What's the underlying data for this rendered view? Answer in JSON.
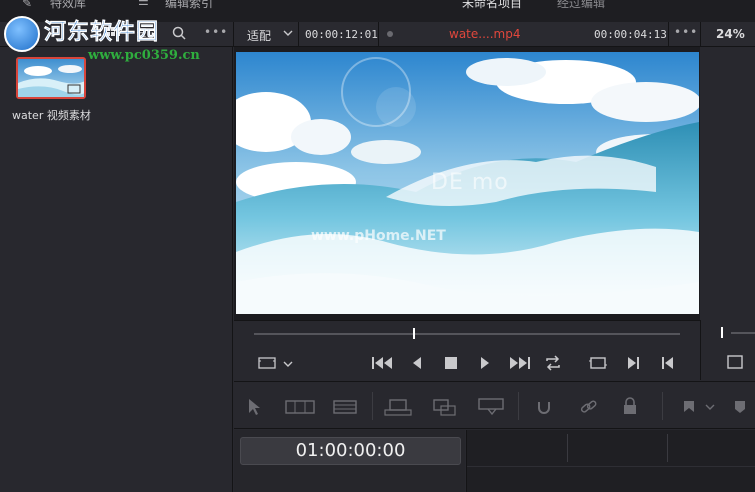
{
  "top_menu": {
    "effects_label": "特效库",
    "edit_index_label": "编辑索引",
    "project_title": "未命名项目",
    "edited_label": "经过编辑"
  },
  "toolbar": {
    "fit_label": "适配",
    "source_timecode": "00:00:12:01",
    "clip_name": "wate....mp4",
    "clip_duration": "00:00:04:13",
    "zoom_level": "24%"
  },
  "media_pool": {
    "clip_label": "water 视频素材"
  },
  "timeline": {
    "timecode": "01:00:00:00"
  },
  "overlays": {
    "site_watermark_title": "河东软件园",
    "site_watermark_url": "www.pc0359.cn",
    "video_demo_text": "DE mo",
    "video_url_text": "www.pHome.NET"
  },
  "colors": {
    "accent_red": "#d8453b",
    "background": "#28282e",
    "watermark_blue": "#1f6fc9"
  }
}
